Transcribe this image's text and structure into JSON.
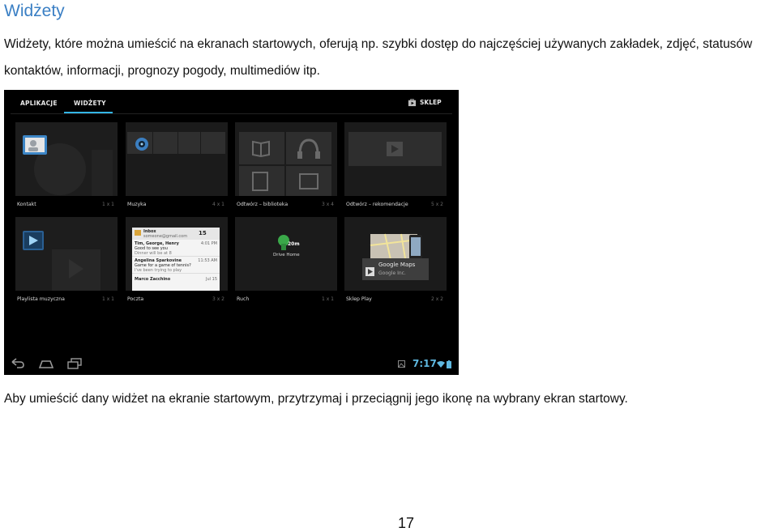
{
  "heading": "Widżety",
  "intro": "Widżety, które można umieścić na ekranach startowych, oferują np. szybki dostęp do najczęściej używanych zakładek, zdjęć, statusów kontaktów, informacji, prognozy pogody, multimediów itp.",
  "screenshot": {
    "tabs": [
      "APLIKACJE",
      "WIDŻETY"
    ],
    "store_label": "SKLEP",
    "widgets": [
      {
        "name": "Kontakt",
        "size": "1 x 1"
      },
      {
        "name": "Muzyka",
        "size": "4 x 1"
      },
      {
        "name": "Odtwórz – biblioteka",
        "size": "3 x 4"
      },
      {
        "name": "Odtwórz – rekomendacje",
        "size": "5 x 2"
      },
      {
        "name": "Playlista muzyczna",
        "size": "1 x 1"
      },
      {
        "name": "Poczta",
        "size": "3 x 2"
      },
      {
        "name": "Ruch",
        "size": "1 x 1"
      },
      {
        "name": "Sklep Play",
        "size": "2 x 2"
      }
    ],
    "mail_preview": {
      "folder": "Inbox",
      "account": "someone@gmail.com",
      "count": "15",
      "messages": [
        {
          "from": "Tim, George, Henry",
          "time": "4:01 PM",
          "line": "Good to see you",
          "snippet": "Dinner will be at 8"
        },
        {
          "from": "Angelina Sparkovine",
          "time": "11:53 AM",
          "line": "Game for a game of tennis?",
          "snippet": "I've been trying to play"
        },
        {
          "from": "Marco Zacchino",
          "time": "Jul 15",
          "line": "",
          "snippet": ""
        }
      ]
    },
    "traffic_preview": {
      "minutes": "20m",
      "label": "Drive Home"
    },
    "play_store_preview": {
      "app": "Google Maps",
      "publisher": "Google Inc."
    },
    "clock": "7:17"
  },
  "outro": "Aby umieścić dany widżet na ekranie startowym, przytrzymaj i przeciągnij jego ikonę na wybrany ekran startowy.",
  "page_number": "17",
  "colors": {
    "heading": "#3a7fc4",
    "tab_accent": "#33b5e5",
    "clock": "#5fb8e0"
  }
}
